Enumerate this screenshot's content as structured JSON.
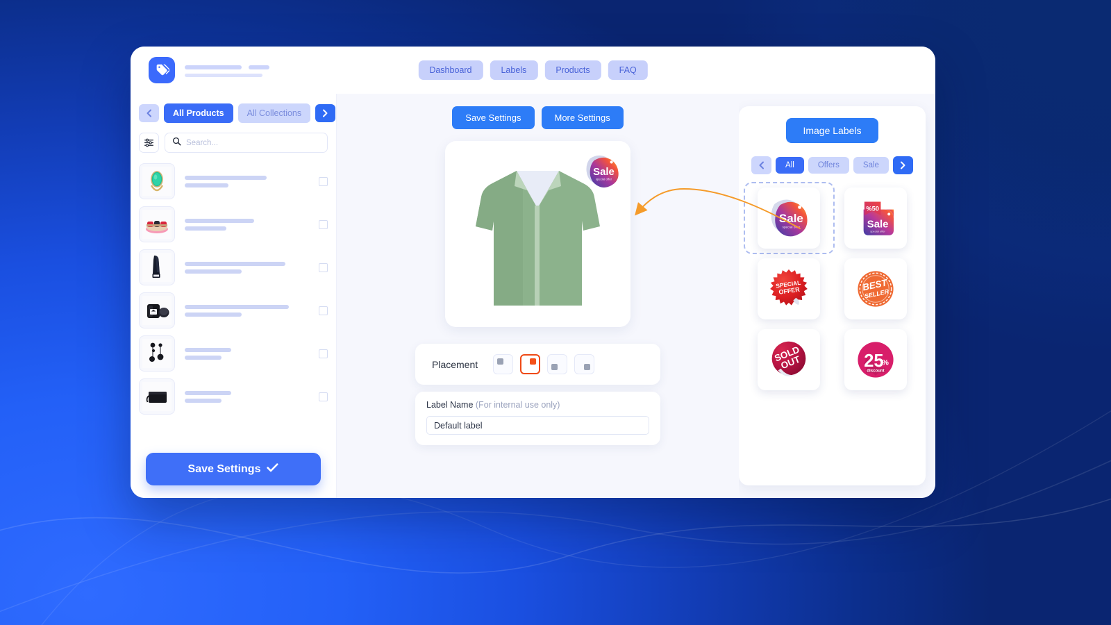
{
  "background": {
    "accent_blue": "#2f6bff",
    "deep_navy": "#0a2a72"
  },
  "header": {
    "logo_icon": "price-tag-icon",
    "nav_tabs": [
      {
        "label": "Dashboard"
      },
      {
        "label": "Labels"
      },
      {
        "label": "Products"
      },
      {
        "label": "FAQ"
      }
    ]
  },
  "sidebar": {
    "prev_icon": "chevron-left-icon",
    "next_icon": "chevron-right-icon",
    "tabs": [
      {
        "label": "All Products",
        "active": true
      },
      {
        "label": "All Collections",
        "active": false
      }
    ],
    "filter_icon": "sliders-icon",
    "search": {
      "placeholder": "Search...",
      "value": "",
      "icon": "search-icon"
    },
    "products": [
      {
        "thumb": "emerald-ring",
        "checked": false
      },
      {
        "thumb": "red-sandals",
        "checked": false
      },
      {
        "thumb": "black-boot",
        "checked": false
      },
      {
        "thumb": "candle-jar",
        "checked": false
      },
      {
        "thumb": "drop-earrings",
        "checked": false
      },
      {
        "thumb": "clutch-bag",
        "checked": false
      }
    ],
    "save_button": {
      "label": "Save Settings",
      "icon": "check-icon"
    }
  },
  "center": {
    "actions": [
      {
        "label": "Save Settings"
      },
      {
        "label": "More Settings"
      }
    ],
    "preview": {
      "product": "green-short-sleeve-shirt",
      "applied_label": "sale-sticker",
      "label_position": "top-right"
    },
    "placement": {
      "label": "Placement",
      "options": [
        {
          "position": "top-left",
          "selected": false
        },
        {
          "position": "top-right",
          "selected": true
        },
        {
          "position": "bottom-left",
          "selected": false
        },
        {
          "position": "bottom-right",
          "selected": false
        }
      ],
      "selected_color": "#f4521a"
    },
    "label_name": {
      "title": "Label Name",
      "hint": "(For internal use only)",
      "value": "Default label",
      "placeholder": "Default label"
    }
  },
  "right_panel": {
    "title": "Image Labels",
    "prev_icon": "chevron-left-icon",
    "next_icon": "chevron-right-icon",
    "filters": [
      {
        "label": "All",
        "active": true
      },
      {
        "label": "Offers",
        "active": false
      },
      {
        "label": "Sale",
        "active": false
      }
    ],
    "stickers": [
      {
        "name": "sale-blob-sticker",
        "text": "Sale",
        "subtext": "special offer",
        "selected": true
      },
      {
        "name": "sale-50-tag-sticker",
        "text": "Sale",
        "subtext": "special offer",
        "badge": "%50",
        "selected": false
      },
      {
        "name": "special-offer-burst-sticker",
        "line1": "SPECIAL",
        "line2": "OFFER",
        "selected": false
      },
      {
        "name": "best-seller-stamp-sticker",
        "line1": "BEST",
        "line2": "SELLER",
        "selected": false
      },
      {
        "name": "sold-out-sticker",
        "line1": "SOLD",
        "line2": "OUT",
        "selected": false
      },
      {
        "name": "discount-25-sticker",
        "number": "25",
        "percent": "%",
        "subtext": "discount",
        "selected": false
      }
    ]
  }
}
